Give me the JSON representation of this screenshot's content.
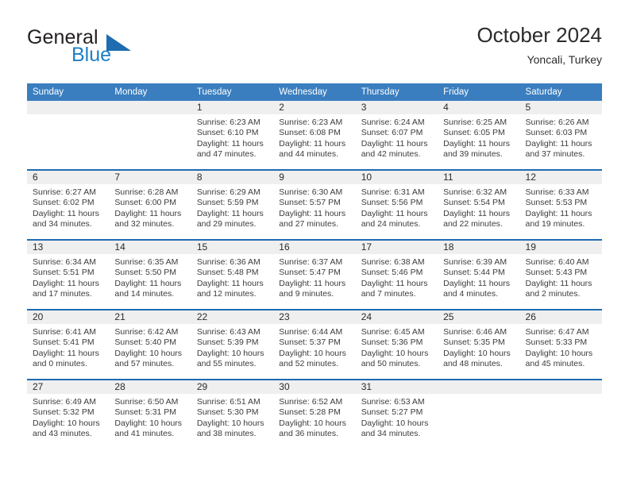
{
  "brand": {
    "name_part1": "General",
    "name_part2": "Blue",
    "flag_color": "#1f7fc4"
  },
  "header": {
    "title": "October 2024",
    "subtitle": "Yoncali, Turkey"
  },
  "theme": {
    "header_bar": "#3a7ebf",
    "row_divider": "#1f6cb0",
    "daynum_band": "#efefef",
    "text": "#2b2b2b"
  },
  "columns": [
    "Sunday",
    "Monday",
    "Tuesday",
    "Wednesday",
    "Thursday",
    "Friday",
    "Saturday"
  ],
  "weeks": [
    [
      {
        "day": "",
        "sunrise": "",
        "sunset": "",
        "daylight": ""
      },
      {
        "day": "",
        "sunrise": "",
        "sunset": "",
        "daylight": ""
      },
      {
        "day": "1",
        "sunrise": "Sunrise: 6:23 AM",
        "sunset": "Sunset: 6:10 PM",
        "daylight": "Daylight: 11 hours and 47 minutes."
      },
      {
        "day": "2",
        "sunrise": "Sunrise: 6:23 AM",
        "sunset": "Sunset: 6:08 PM",
        "daylight": "Daylight: 11 hours and 44 minutes."
      },
      {
        "day": "3",
        "sunrise": "Sunrise: 6:24 AM",
        "sunset": "Sunset: 6:07 PM",
        "daylight": "Daylight: 11 hours and 42 minutes."
      },
      {
        "day": "4",
        "sunrise": "Sunrise: 6:25 AM",
        "sunset": "Sunset: 6:05 PM",
        "daylight": "Daylight: 11 hours and 39 minutes."
      },
      {
        "day": "5",
        "sunrise": "Sunrise: 6:26 AM",
        "sunset": "Sunset: 6:03 PM",
        "daylight": "Daylight: 11 hours and 37 minutes."
      }
    ],
    [
      {
        "day": "6",
        "sunrise": "Sunrise: 6:27 AM",
        "sunset": "Sunset: 6:02 PM",
        "daylight": "Daylight: 11 hours and 34 minutes."
      },
      {
        "day": "7",
        "sunrise": "Sunrise: 6:28 AM",
        "sunset": "Sunset: 6:00 PM",
        "daylight": "Daylight: 11 hours and 32 minutes."
      },
      {
        "day": "8",
        "sunrise": "Sunrise: 6:29 AM",
        "sunset": "Sunset: 5:59 PM",
        "daylight": "Daylight: 11 hours and 29 minutes."
      },
      {
        "day": "9",
        "sunrise": "Sunrise: 6:30 AM",
        "sunset": "Sunset: 5:57 PM",
        "daylight": "Daylight: 11 hours and 27 minutes."
      },
      {
        "day": "10",
        "sunrise": "Sunrise: 6:31 AM",
        "sunset": "Sunset: 5:56 PM",
        "daylight": "Daylight: 11 hours and 24 minutes."
      },
      {
        "day": "11",
        "sunrise": "Sunrise: 6:32 AM",
        "sunset": "Sunset: 5:54 PM",
        "daylight": "Daylight: 11 hours and 22 minutes."
      },
      {
        "day": "12",
        "sunrise": "Sunrise: 6:33 AM",
        "sunset": "Sunset: 5:53 PM",
        "daylight": "Daylight: 11 hours and 19 minutes."
      }
    ],
    [
      {
        "day": "13",
        "sunrise": "Sunrise: 6:34 AM",
        "sunset": "Sunset: 5:51 PM",
        "daylight": "Daylight: 11 hours and 17 minutes."
      },
      {
        "day": "14",
        "sunrise": "Sunrise: 6:35 AM",
        "sunset": "Sunset: 5:50 PM",
        "daylight": "Daylight: 11 hours and 14 minutes."
      },
      {
        "day": "15",
        "sunrise": "Sunrise: 6:36 AM",
        "sunset": "Sunset: 5:48 PM",
        "daylight": "Daylight: 11 hours and 12 minutes."
      },
      {
        "day": "16",
        "sunrise": "Sunrise: 6:37 AM",
        "sunset": "Sunset: 5:47 PM",
        "daylight": "Daylight: 11 hours and 9 minutes."
      },
      {
        "day": "17",
        "sunrise": "Sunrise: 6:38 AM",
        "sunset": "Sunset: 5:46 PM",
        "daylight": "Daylight: 11 hours and 7 minutes."
      },
      {
        "day": "18",
        "sunrise": "Sunrise: 6:39 AM",
        "sunset": "Sunset: 5:44 PM",
        "daylight": "Daylight: 11 hours and 4 minutes."
      },
      {
        "day": "19",
        "sunrise": "Sunrise: 6:40 AM",
        "sunset": "Sunset: 5:43 PM",
        "daylight": "Daylight: 11 hours and 2 minutes."
      }
    ],
    [
      {
        "day": "20",
        "sunrise": "Sunrise: 6:41 AM",
        "sunset": "Sunset: 5:41 PM",
        "daylight": "Daylight: 11 hours and 0 minutes."
      },
      {
        "day": "21",
        "sunrise": "Sunrise: 6:42 AM",
        "sunset": "Sunset: 5:40 PM",
        "daylight": "Daylight: 10 hours and 57 minutes."
      },
      {
        "day": "22",
        "sunrise": "Sunrise: 6:43 AM",
        "sunset": "Sunset: 5:39 PM",
        "daylight": "Daylight: 10 hours and 55 minutes."
      },
      {
        "day": "23",
        "sunrise": "Sunrise: 6:44 AM",
        "sunset": "Sunset: 5:37 PM",
        "daylight": "Daylight: 10 hours and 52 minutes."
      },
      {
        "day": "24",
        "sunrise": "Sunrise: 6:45 AM",
        "sunset": "Sunset: 5:36 PM",
        "daylight": "Daylight: 10 hours and 50 minutes."
      },
      {
        "day": "25",
        "sunrise": "Sunrise: 6:46 AM",
        "sunset": "Sunset: 5:35 PM",
        "daylight": "Daylight: 10 hours and 48 minutes."
      },
      {
        "day": "26",
        "sunrise": "Sunrise: 6:47 AM",
        "sunset": "Sunset: 5:33 PM",
        "daylight": "Daylight: 10 hours and 45 minutes."
      }
    ],
    [
      {
        "day": "27",
        "sunrise": "Sunrise: 6:49 AM",
        "sunset": "Sunset: 5:32 PM",
        "daylight": "Daylight: 10 hours and 43 minutes."
      },
      {
        "day": "28",
        "sunrise": "Sunrise: 6:50 AM",
        "sunset": "Sunset: 5:31 PM",
        "daylight": "Daylight: 10 hours and 41 minutes."
      },
      {
        "day": "29",
        "sunrise": "Sunrise: 6:51 AM",
        "sunset": "Sunset: 5:30 PM",
        "daylight": "Daylight: 10 hours and 38 minutes."
      },
      {
        "day": "30",
        "sunrise": "Sunrise: 6:52 AM",
        "sunset": "Sunset: 5:28 PM",
        "daylight": "Daylight: 10 hours and 36 minutes."
      },
      {
        "day": "31",
        "sunrise": "Sunrise: 6:53 AM",
        "sunset": "Sunset: 5:27 PM",
        "daylight": "Daylight: 10 hours and 34 minutes."
      },
      {
        "day": "",
        "sunrise": "",
        "sunset": "",
        "daylight": ""
      },
      {
        "day": "",
        "sunrise": "",
        "sunset": "",
        "daylight": ""
      }
    ]
  ]
}
